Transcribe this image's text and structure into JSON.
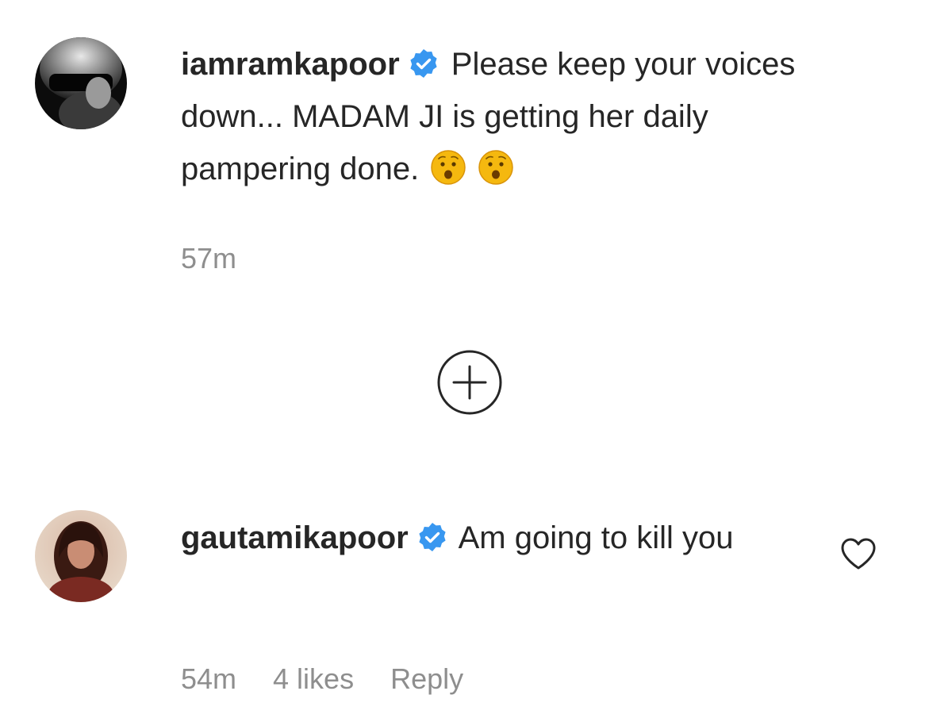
{
  "comments": [
    {
      "username": "iamramkapoor",
      "verified": true,
      "text": "Please keep your voices down... MADAM JI is getting her daily pampering done.",
      "emojis": [
        "hushed-face-emoji",
        "hushed-face-emoji"
      ],
      "timestamp": "57m"
    },
    {
      "username": "gautamikapoor",
      "verified": true,
      "text": "Am going to kill you",
      "timestamp": "54m",
      "likes": "4 likes",
      "reply_label": "Reply"
    }
  ],
  "icons": {
    "verified": "verified-badge-icon",
    "expand": "plus-circle-icon",
    "like": "heart-icon"
  },
  "colors": {
    "verified_blue": "#3897f0",
    "meta_gray": "#8e8e8e",
    "text": "#262626"
  }
}
